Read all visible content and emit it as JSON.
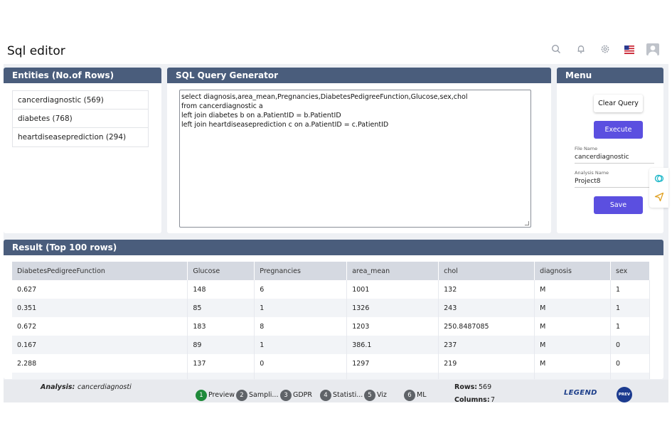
{
  "header": {
    "title": "Sql editor",
    "icons": [
      "search-icon",
      "bell-icon",
      "gear-icon",
      "us-flag-icon",
      "user-avatar-icon"
    ]
  },
  "entities": {
    "title": "Entities (No.of Rows)",
    "items": [
      {
        "label": "cancerdiagnostic (569)"
      },
      {
        "label": "diabetes (768)"
      },
      {
        "label": "heartdiseaseprediction (294)"
      }
    ]
  },
  "sql": {
    "title": "SQL Query Generator",
    "lines": [
      "select diagnosis,area_mean,Pregnancies,DiabetesPedigreeFunction,Glucose,sex,chol",
      "from cancerdiagnostic a",
      "left join diabetes b on a.PatientID = b.PatientID",
      "left join heartdiseaseprediction c on a.PatientID = c.PatientID"
    ]
  },
  "menu": {
    "title": "Menu",
    "clear_label": "Clear Query",
    "execute_label": "Execute",
    "file_name_label": "File Name",
    "file_name_value": "cancerdiagnostic",
    "analysis_name_label": "Analysis Name",
    "analysis_name_value": "Project8",
    "save_label": "Save"
  },
  "result": {
    "title": "Result (Top 100 rows)",
    "columns": [
      "DiabetesPedigreeFunction",
      "Glucose",
      "Pregnancies",
      "area_mean",
      "chol",
      "diagnosis",
      "sex"
    ],
    "rows": [
      [
        "0.627",
        "148",
        "6",
        "1001",
        "132",
        "M",
        "1"
      ],
      [
        "0.351",
        "85",
        "1",
        "1326",
        "243",
        "M",
        "1"
      ],
      [
        "0.672",
        "183",
        "8",
        "1203",
        "250.8487085",
        "M",
        "1"
      ],
      [
        "0.167",
        "89",
        "1",
        "386.1",
        "237",
        "M",
        "0"
      ],
      [
        "2.288",
        "137",
        "0",
        "1297",
        "219",
        "M",
        "0"
      ],
      [
        "",
        "",
        "",
        "",
        "",
        "",
        ""
      ]
    ]
  },
  "footer": {
    "analysis_label": "Analysis:",
    "analysis_value": "cancerdiagnosti",
    "steps": [
      {
        "num": "1",
        "label": "Preview"
      },
      {
        "num": "2",
        "label": "Sampli..."
      },
      {
        "num": "3",
        "label": "GDPR"
      },
      {
        "num": "4",
        "label": "Statisti..."
      },
      {
        "num": "5",
        "label": "Viz"
      },
      {
        "num": "6",
        "label": "ML"
      }
    ],
    "rows_label": "Rows:",
    "rows_value": "569",
    "columns_label": "Columns:",
    "columns_value": "7",
    "legend_logo": "LEGEND",
    "prev_logo": "PREV"
  },
  "colors": {
    "panel_header": "#4a5d7c",
    "primary_button": "#5b4fe0",
    "active_step": "#1f8a3a",
    "step": "#5f6368"
  }
}
